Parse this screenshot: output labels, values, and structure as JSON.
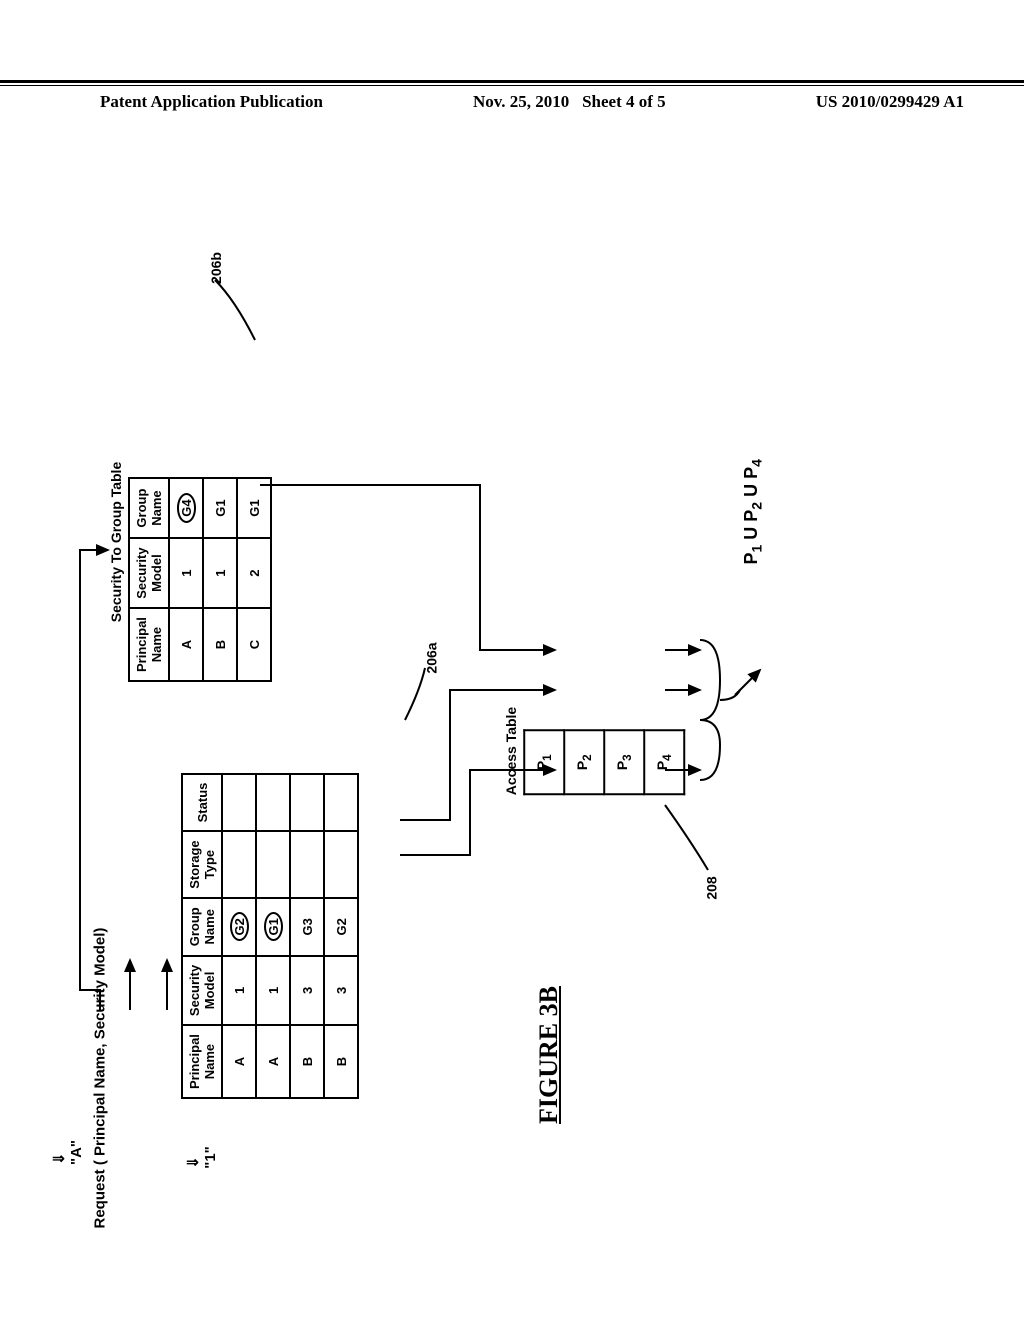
{
  "header": {
    "left": "Patent Application Publication",
    "center_date": "Nov. 25, 2010",
    "center_sheet": "Sheet 4 of 5",
    "right": "US 2010/0299429 A1"
  },
  "labels": {
    "sec_to_group": "Security To Group Table",
    "access_table": "Access Table",
    "ref_206b": "206b",
    "ref_206a": "206a",
    "ref_208": "208",
    "figure": "FIGURE 3B",
    "request": "Request ( Principal Name, Security Model)",
    "req_a": "\"A\"",
    "req_1": "\"1\"",
    "union": "P₁ U P₂ U P₄"
  },
  "table_206b": {
    "headers": [
      "Principal Name",
      "Security Model",
      "Group Name"
    ],
    "rows": [
      [
        "A",
        "1",
        "G4",
        true
      ],
      [
        "B",
        "1",
        "G1",
        false
      ],
      [
        "C",
        "2",
        "G1",
        false
      ]
    ]
  },
  "table_206a": {
    "headers": [
      "Principal Name",
      "Security Model",
      "Group Name",
      "Storage Type",
      "Status"
    ],
    "rows": [
      [
        "A",
        "1",
        "G2",
        "",
        "",
        true
      ],
      [
        "A",
        "1",
        "G1",
        "",
        "",
        true
      ],
      [
        "B",
        "3",
        "G3",
        "",
        "",
        false
      ],
      [
        "B",
        "3",
        "G2",
        "",
        "",
        false
      ]
    ]
  },
  "access_table": {
    "rows": [
      "P₁",
      "P₂",
      "P₃",
      "P₄"
    ]
  }
}
